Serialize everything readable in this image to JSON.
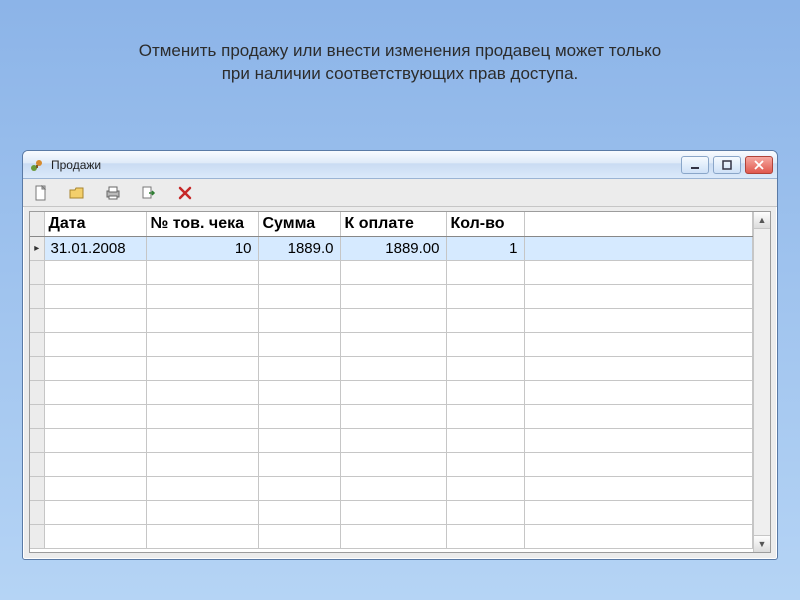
{
  "caption": {
    "line1": "Отменить продажу или внести изменения продавец может только",
    "line2": "при наличии соответствующих прав доступа."
  },
  "window": {
    "title": "Продажи"
  },
  "toolbar": {
    "new": "new-doc-icon",
    "open": "open-folder-icon",
    "print": "print-icon",
    "export": "export-icon",
    "delete": "delete-icon"
  },
  "grid": {
    "columns": {
      "date": "Дата",
      "number": "№ тов. чека",
      "sum": "Сумма",
      "pay": "К оплате",
      "qty": "Кол-во"
    },
    "rows": [
      {
        "date": "31.01.2008",
        "number": "10",
        "sum": "1889.0",
        "pay": "1889.00",
        "qty": "1"
      }
    ],
    "empty_row_count": 12
  }
}
